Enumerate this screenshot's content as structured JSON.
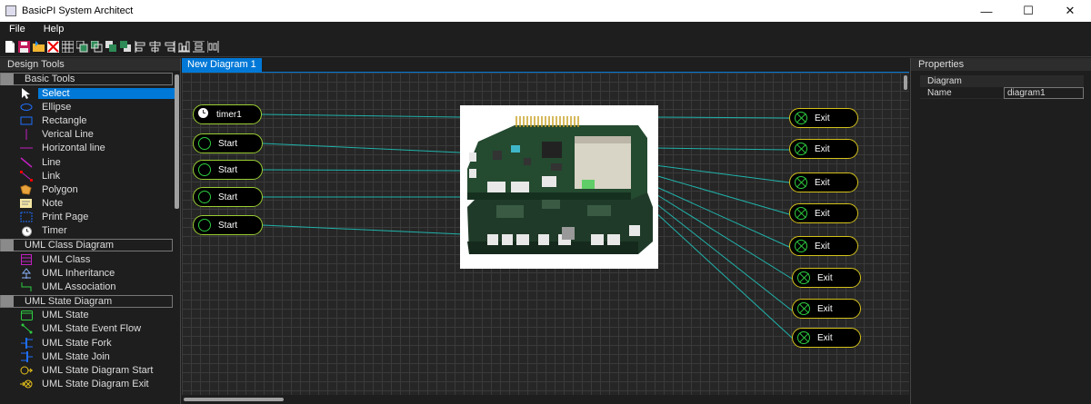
{
  "window": {
    "title": "BasicPI System Architect",
    "controls": {
      "minimize": "—",
      "maximize": "☐",
      "close": "✕"
    }
  },
  "menu": [
    "File",
    "Help"
  ],
  "toolbar_icons": [
    "new-file-icon",
    "save-icon",
    "open-folder-icon",
    "delete-icon",
    "grid-icon",
    "copy-icon",
    "paste-icon",
    "bring-front-icon",
    "send-back-icon",
    "align-left-icon",
    "align-center-icon",
    "align-right-icon",
    "align-bottom-icon",
    "distribute-horizontal-icon",
    "distribute-vertical-icon"
  ],
  "design_tools": {
    "header": "Design Tools",
    "groups": [
      {
        "name": "Basic Tools",
        "items": [
          "Select",
          "Ellipse",
          "Rectangle",
          "Verical Line",
          "Horizontal line",
          "Line",
          "Link",
          "Polygon",
          "Note",
          "Print Page",
          "Timer"
        ]
      },
      {
        "name": "UML Class Diagram",
        "items": [
          "UML Class",
          "UML Inheritance",
          "UML Association"
        ]
      },
      {
        "name": "UML State Diagram",
        "items": [
          "UML State",
          "UML State Event Flow",
          "UML State Fork",
          "UML State Join",
          "UML State Diagram Start",
          "UML State Diagram Exit"
        ]
      }
    ]
  },
  "document_tab": "New Diagram 1",
  "diagram": {
    "timer_label": "timer1",
    "start_label": "Start",
    "exit_label": "Exit",
    "connector_color": "#20b2aa"
  },
  "properties": {
    "header": "Properties",
    "category": "Diagram",
    "rows": [
      {
        "key": "Name",
        "value": "diagram1"
      }
    ]
  },
  "colors": {
    "accent": "#0078d7",
    "start_border": "#9acd32",
    "exit_border": "#d4c21b",
    "state_circle": "#2ecc40"
  }
}
